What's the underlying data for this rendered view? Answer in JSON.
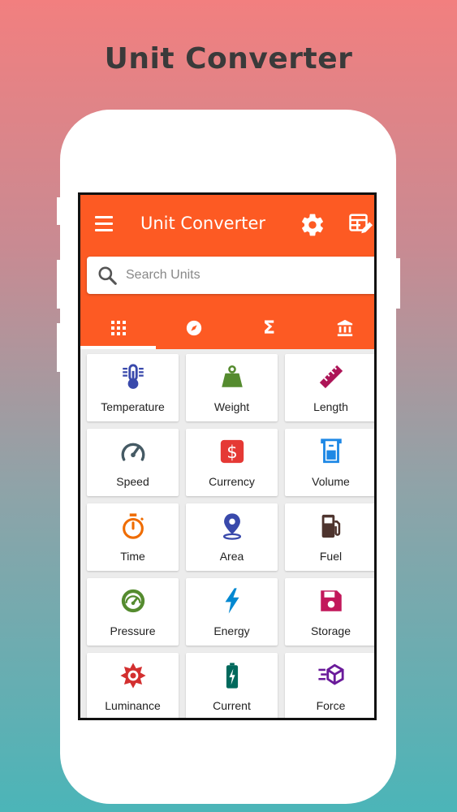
{
  "promo": {
    "title": "Unit Converter"
  },
  "app": {
    "title": "Unit Converter",
    "accent_color": "#fd5a23",
    "icons": [
      "menu-icon",
      "gear-icon",
      "table-edit-icon"
    ]
  },
  "search": {
    "placeholder": "Search Units",
    "value": ""
  },
  "tabs": [
    {
      "icon": "grid-icon",
      "selected": true
    },
    {
      "icon": "compass-icon",
      "selected": false
    },
    {
      "icon": "sigma-icon",
      "selected": false
    },
    {
      "icon": "bank-icon",
      "selected": false
    }
  ],
  "categories": [
    {
      "label": "Temperature",
      "icon": "thermometer-icon",
      "color": "#3949ab"
    },
    {
      "label": "Weight",
      "icon": "weight-icon",
      "color": "#558b2f"
    },
    {
      "label": "Length",
      "icon": "ruler-icon",
      "color": "#ad1457"
    },
    {
      "label": "Speed",
      "icon": "speedometer-icon",
      "color": "#455a64"
    },
    {
      "label": "Currency",
      "icon": "currency-icon",
      "color": "#e53935"
    },
    {
      "label": "Volume",
      "icon": "beaker-icon",
      "color": "#1e88e5"
    },
    {
      "label": "Time",
      "icon": "stopwatch-icon",
      "color": "#ef6c00"
    },
    {
      "label": "Area",
      "icon": "location-pin-icon",
      "color": "#3949ab"
    },
    {
      "label": "Fuel",
      "icon": "fuel-pump-icon",
      "color": "#4e342e"
    },
    {
      "label": "Pressure",
      "icon": "gauge-icon",
      "color": "#558b2f"
    },
    {
      "label": "Energy",
      "icon": "lightning-icon",
      "color": "#0288d1"
    },
    {
      "label": "Storage",
      "icon": "floppy-disk-icon",
      "color": "#c2185b"
    },
    {
      "label": "Luminance",
      "icon": "sun-icon",
      "color": "#d32f2f"
    },
    {
      "label": "Current",
      "icon": "battery-charging-icon",
      "color": "#00695c"
    },
    {
      "label": "Force",
      "icon": "force-cube-icon",
      "color": "#6a1b9a"
    }
  ]
}
